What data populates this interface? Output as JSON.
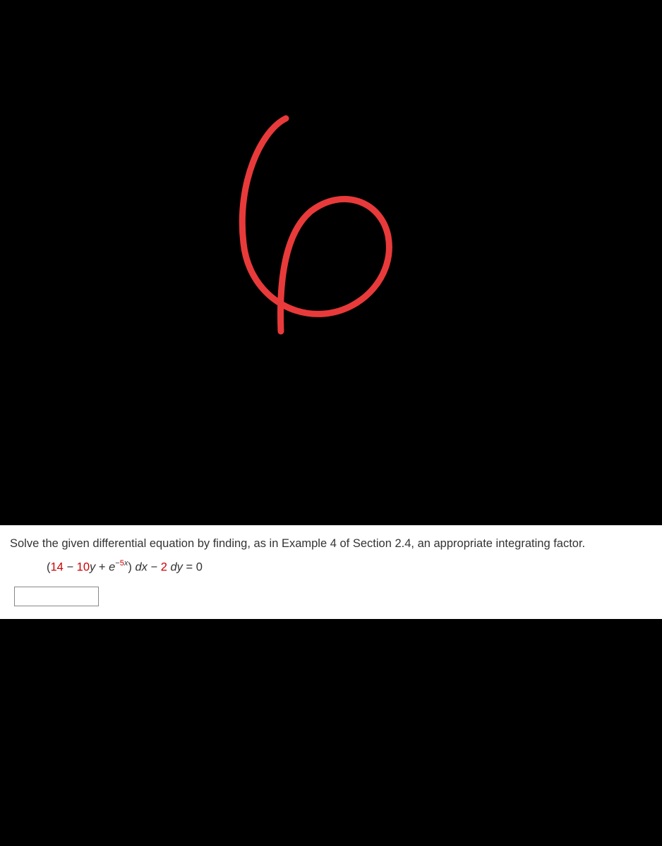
{
  "annotation": {
    "glyph": "6",
    "color": "#e83a3a"
  },
  "problem": {
    "instruction": "Solve the given differential equation by finding, as in Example 4 of Section 2.4, an appropriate integrating factor.",
    "equation": {
      "open": "(",
      "c1": "14",
      "minus1": " − ",
      "c2": "10",
      "y": "y",
      "plus": " + ",
      "e": "e",
      "expNeg": "−",
      "expNum": "5",
      "expVar": "x",
      "close": ") ",
      "dx": "dx",
      "minus2": " − ",
      "c3": "2",
      "sp": " ",
      "dy": "dy",
      "eq": " = ",
      "rhs": "0"
    },
    "answer_value": ""
  }
}
